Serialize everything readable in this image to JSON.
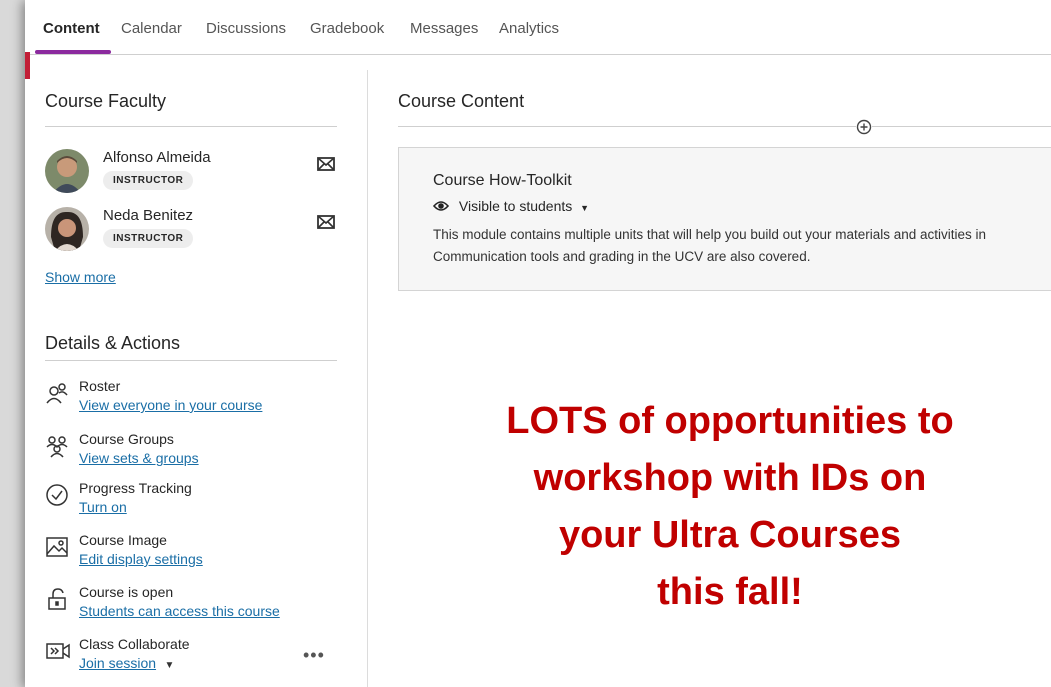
{
  "tabs": [
    {
      "label": "Content",
      "active": true
    },
    {
      "label": "Calendar"
    },
    {
      "label": "Discussions"
    },
    {
      "label": "Gradebook"
    },
    {
      "label": "Messages"
    },
    {
      "label": "Analytics"
    }
  ],
  "faculty": {
    "title": "Course Faculty",
    "members": [
      {
        "name": "Alfonso Almeida",
        "role": "INSTRUCTOR"
      },
      {
        "name": "Neda Benitez",
        "role": "INSTRUCTOR"
      }
    ],
    "show_more": "Show more"
  },
  "details": {
    "title": "Details & Actions",
    "items": [
      {
        "title": "Roster",
        "link": "View everyone in your course",
        "icon": "roster-icon"
      },
      {
        "title": "Course Groups",
        "link": "View sets & groups",
        "icon": "groups-icon"
      },
      {
        "title": "Progress Tracking",
        "link": "Turn on",
        "icon": "check-circle-icon"
      },
      {
        "title": "Course Image",
        "link": "Edit display settings",
        "icon": "image-icon"
      },
      {
        "title": "Course is open",
        "link": "Students can access this course",
        "icon": "unlock-icon"
      },
      {
        "title": "Class Collaborate",
        "link": "Join session",
        "icon": "video-icon"
      }
    ]
  },
  "content": {
    "title": "Course Content",
    "module": {
      "title": "Course How-Toolkit",
      "visibility": "Visible to students",
      "desc_line1": "This module contains multiple units that will help you build out your materials and activities in",
      "desc_line2": "Communication tools and grading in the UCV are also covered."
    }
  },
  "promo": {
    "line1": "LOTS of opportunities to",
    "line2": "workshop with IDs on",
    "line3": "your Ultra Courses",
    "line4": "this fall!"
  },
  "colors": {
    "accent_purple": "#8b2a9e",
    "accent_red": "#c21e36",
    "link": "#1a6ea6",
    "promo": "#c00000"
  }
}
